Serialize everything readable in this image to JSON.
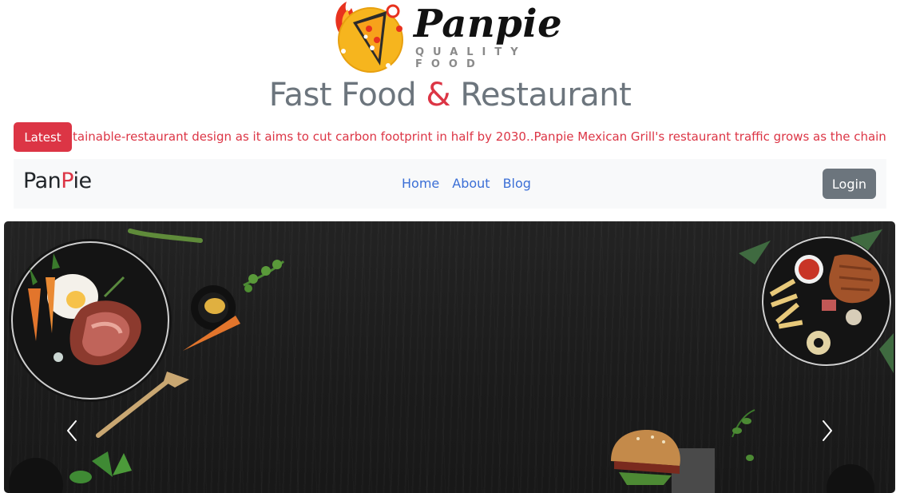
{
  "logo": {
    "wordmark": "Panpie",
    "tagline": "QUALITY FOOD",
    "icon": "pizza-slice-flame-icon"
  },
  "headline": {
    "part1": "Fast Food ",
    "amp": "&",
    "part2": " Restaurant"
  },
  "ticker": {
    "badge": "Latest",
    "text": "tainable-restaurant design as it aims to cut carbon footprint in half by 2030..Panpie Mexican Grill's restaurant traffic grows as the chain prov"
  },
  "navbar": {
    "brand_start": "Pan",
    "brand_accent": "P",
    "brand_end": "ie",
    "links": [
      "Home",
      "About",
      "Blog"
    ],
    "login": "Login"
  },
  "carousel": {
    "prev_icon": "chevron-left-icon",
    "next_icon": "chevron-right-icon"
  },
  "colors": {
    "accent": "#dc3545",
    "muted": "#6c757d",
    "link": "#3b6fd6",
    "navbar_bg": "#f8f9fa"
  }
}
